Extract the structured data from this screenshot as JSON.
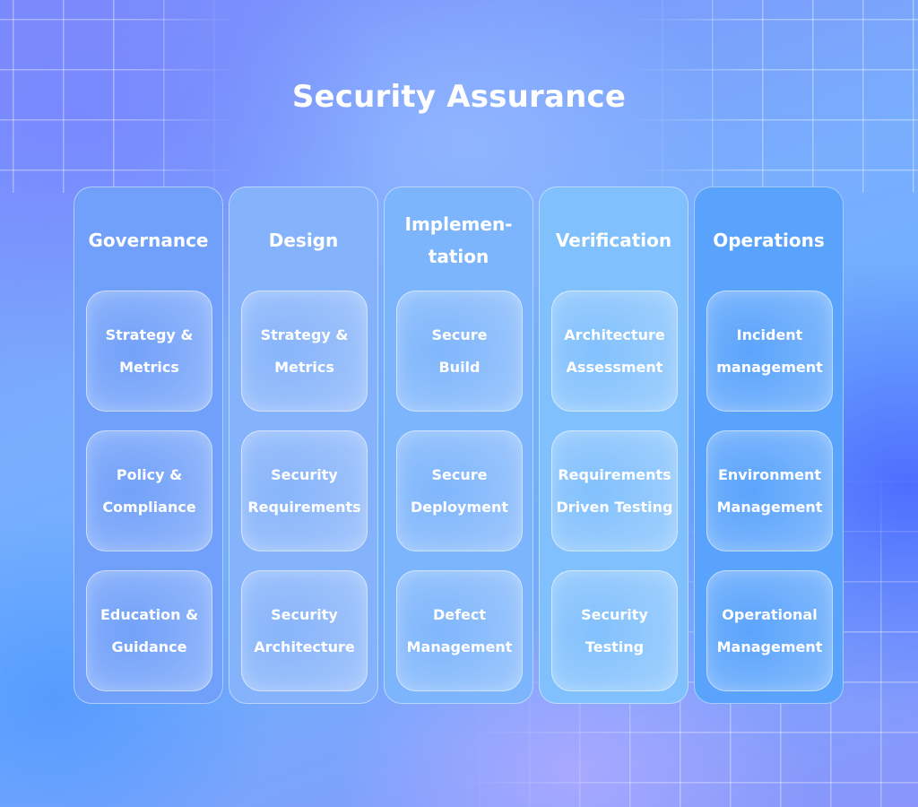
{
  "title": "Security Assurance",
  "columns": [
    {
      "label": "Governance",
      "color": "#70a0fa",
      "practices": [
        "Strategy &\nMetrics",
        "Policy &\nCompliance",
        "Education &\nGuidance"
      ]
    },
    {
      "label": "Design",
      "color": "#85b3fb",
      "practices": [
        "Strategy &\nMetrics",
        "Security\nRequirements",
        "Security\nArchitecture"
      ]
    },
    {
      "label": "Implemen-\ntation",
      "color": "#7db5fc",
      "practices": [
        "Secure\nBuild",
        "Secure\nDeployment",
        "Defect\nManagement"
      ]
    },
    {
      "label": "Verification",
      "color": "#80c0fd",
      "practices": [
        "Architecture\nAssessment",
        "Requirements\nDriven Testing",
        "Security\nTesting"
      ]
    },
    {
      "label": "Operations",
      "color": "#59a3fc",
      "practices": [
        "Incident\nmanagement",
        "Environment\nManagement",
        "Operational\nManagement"
      ]
    }
  ]
}
